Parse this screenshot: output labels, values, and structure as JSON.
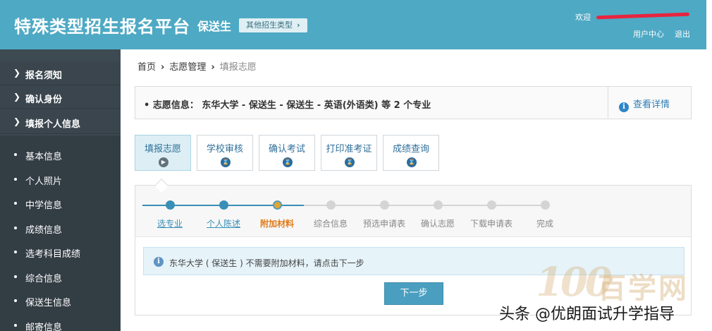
{
  "header": {
    "title": "特殊类型招生报名平台",
    "subtype": "保送生",
    "other_types_label": "其他招生类型",
    "welcome_label": "欢迎",
    "user_center": "用户中心",
    "logout": "退出"
  },
  "sidebar": {
    "sections": [
      {
        "label": "报名须知"
      },
      {
        "label": "确认身份"
      },
      {
        "label": "填报个人信息"
      }
    ],
    "items": [
      {
        "label": "基本信息"
      },
      {
        "label": "个人照片"
      },
      {
        "label": "中学信息"
      },
      {
        "label": "成绩信息"
      },
      {
        "label": "选考科目成绩"
      },
      {
        "label": "综合信息"
      },
      {
        "label": "保送生信息"
      },
      {
        "label": "邮寄信息"
      }
    ]
  },
  "breadcrumb": {
    "home": "首页",
    "level2": "志愿管理",
    "current": "填报志愿"
  },
  "info_bar": {
    "text": "志愿信息： 东华大学 - 保送生 - 保送生 - 英语(外语类) 等 2 个专业",
    "detail_link": "查看详情"
  },
  "tabs": [
    {
      "label": "填报志愿",
      "active": true
    },
    {
      "label": "学校审核",
      "active": false
    },
    {
      "label": "确认考试",
      "active": false
    },
    {
      "label": "打印准考证",
      "active": false
    },
    {
      "label": "成绩查询",
      "active": false
    }
  ],
  "steps": [
    {
      "label": "选专业",
      "state": "done"
    },
    {
      "label": "个人陈述",
      "state": "done"
    },
    {
      "label": "附加材料",
      "state": "current"
    },
    {
      "label": "综合信息",
      "state": "todo"
    },
    {
      "label": "预选申请表",
      "state": "todo"
    },
    {
      "label": "确认志愿",
      "state": "todo"
    },
    {
      "label": "下载申请表",
      "state": "todo"
    },
    {
      "label": "完成",
      "state": "todo"
    }
  ],
  "colors": {
    "done": "#3a8fb7",
    "current": "#e3a72f",
    "todo": "#d4d4d4"
  },
  "notice": {
    "text": "东华大学 ( 保送生 ) 不需要附加材料，请点击下一步"
  },
  "next_button": "下一步",
  "watermark": {
    "logo": "100",
    "site": "百学网",
    "author": "头条 @优朗面试升学指导"
  }
}
